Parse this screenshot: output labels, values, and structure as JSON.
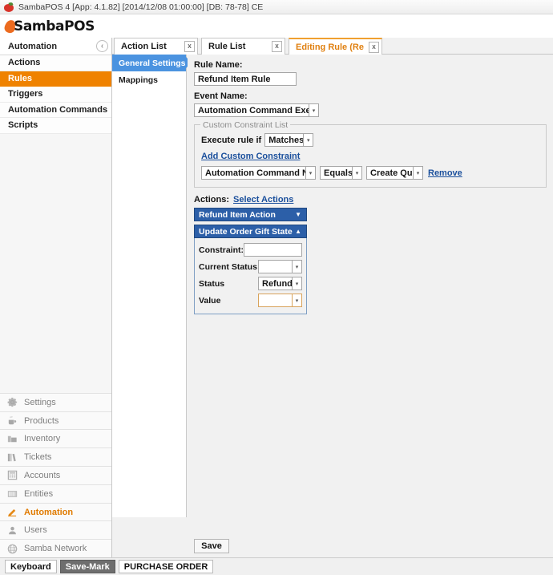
{
  "titlebar": {
    "icon": "apple-icon",
    "text": "SambaPOS 4 [App: 4.1.82] [2014/12/08 01:00:00] [DB: 78-78] CE"
  },
  "brand": {
    "name": "SambaPOS",
    "accent": "#ec6b1f"
  },
  "leftnav": {
    "header": "Automation",
    "collapse_icon": "chevron-left-circle-icon",
    "items": [
      {
        "label": "Actions",
        "active": false
      },
      {
        "label": "Rules",
        "active": true
      },
      {
        "label": "Triggers",
        "active": false
      },
      {
        "label": "Automation Commands",
        "active": false
      },
      {
        "label": "Scripts",
        "active": false
      }
    ],
    "active_color": "#ef8200"
  },
  "modules": [
    {
      "label": "Settings",
      "icon": "gear-icon",
      "active": false
    },
    {
      "label": "Products",
      "icon": "cup-icon",
      "active": false
    },
    {
      "label": "Inventory",
      "icon": "box-icon",
      "active": false
    },
    {
      "label": "Tickets",
      "icon": "books-icon",
      "active": false
    },
    {
      "label": "Accounts",
      "icon": "calculator-icon",
      "active": false
    },
    {
      "label": "Entities",
      "icon": "grid-icon",
      "active": false
    },
    {
      "label": "Automation",
      "icon": "pencil-icon",
      "active": true
    },
    {
      "label": "Users",
      "icon": "person-icon",
      "active": false
    },
    {
      "label": "Samba Network",
      "icon": "globe-icon",
      "active": false
    }
  ],
  "tabs": [
    {
      "label": "Action List",
      "close": "x",
      "active": false
    },
    {
      "label": "Rule List",
      "close": "x",
      "active": false
    },
    {
      "label": "Editing Rule (Refund",
      "close": "x",
      "active": true
    }
  ],
  "innernav": {
    "items": [
      {
        "label": "General Settings",
        "active": true
      },
      {
        "label": "Mappings",
        "active": false
      }
    ],
    "active_color": "#4b93e0"
  },
  "form": {
    "rule_name_label": "Rule Name:",
    "rule_name_value": "Refund Item Rule",
    "event_name_label": "Event Name:",
    "event_name_value": "Automation Command Executed",
    "constraint_group": {
      "title": "Custom Constraint List",
      "execute_label": "Execute rule if",
      "execute_value": "Matches",
      "add_link": "Add Custom Constraint",
      "constraint_rows": [
        {
          "left": "Automation Command Name",
          "operator": "Equals",
          "right": "Create Quote",
          "remove": "Remove"
        }
      ]
    },
    "actions_label": "Actions:",
    "select_actions_link": "Select Actions",
    "action_list": [
      {
        "title": "Refund Item Action",
        "expanded": false,
        "chevron": "chevron-down-icon",
        "fields": []
      },
      {
        "title": "Update Order Gift State",
        "expanded": true,
        "chevron": "chevron-up-icon",
        "fields": [
          {
            "label": "Constraint:",
            "type": "textbox",
            "value": "",
            "focused": false
          },
          {
            "label": "Current Status",
            "type": "combo",
            "value": "",
            "focused": false
          },
          {
            "label": "Status",
            "type": "combo",
            "value": "Refund",
            "focused": false
          },
          {
            "label": "Value",
            "type": "combo",
            "value": "",
            "focused": true
          }
        ]
      }
    ],
    "save_label": "Save",
    "accent_blue": "#2c5fa8",
    "link_color": "#1a4f9c"
  },
  "statusbar": {
    "buttons": [
      {
        "label": "Keyboard",
        "selected": false
      },
      {
        "label": "Save-Mark",
        "selected": true
      },
      {
        "label": "PURCHASE ORDER",
        "selected": false
      }
    ]
  }
}
